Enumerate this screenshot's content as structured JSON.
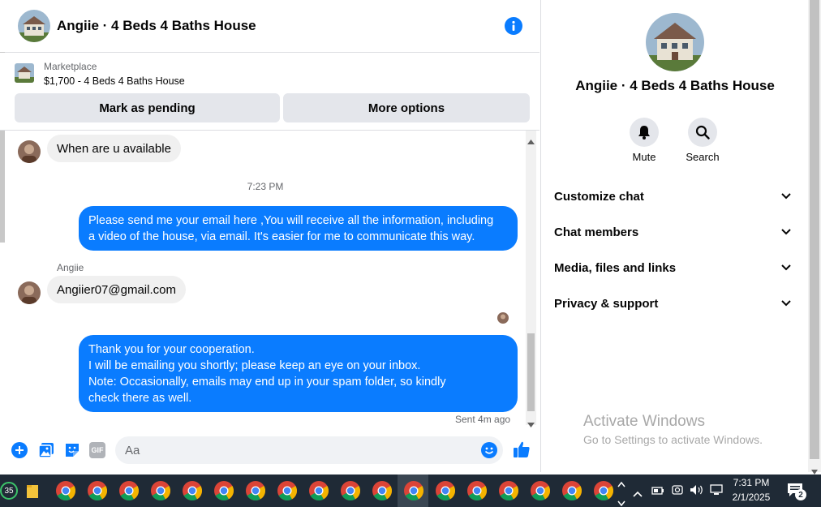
{
  "header": {
    "title": "Angiie · 4 Beds 4 Baths House",
    "info_icon": "info-icon"
  },
  "listing": {
    "source": "Marketplace",
    "title": "$1,700 - 4 Beds 4 Baths House",
    "pending_label": "Mark as pending",
    "more_label": "More options"
  },
  "messages": {
    "m1": "When are u available",
    "timestamp": "7:23 PM",
    "m2_lines": [
      "Please send me your email here ,You will receive all the information, including",
      "a video of the house, via email. It's easier for me to communicate this way."
    ],
    "sender": "Angiie",
    "m3": "Angiier07@gmail.com",
    "m4_lines": [
      "Thank you for your cooperation.",
      "I will be emailing you shortly; please keep an eye on your inbox.",
      "Note: Occasionally, emails may end up in your spam folder, so kindly",
      "check there as well."
    ],
    "sent_status": "Sent 4m ago"
  },
  "composer": {
    "placeholder": "Aa",
    "gif_label": "GIF"
  },
  "panel": {
    "title": "Angiie · 4 Beds 4 Baths House",
    "mute_label": "Mute",
    "search_label": "Search",
    "rows": [
      "Customize chat",
      "Chat members",
      "Media, files and links",
      "Privacy & support"
    ]
  },
  "watermark": {
    "title": "Activate Windows",
    "subtitle": "Go to Settings to activate Windows."
  },
  "taskbar": {
    "badge_left": "35",
    "time": "7:31 PM",
    "date": "2/1/2025",
    "notification_count": "2"
  },
  "colors": {
    "accent": "#0a7cff",
    "bubble_in": "#f0f0f0",
    "button_bg": "#e4e6eb",
    "taskbar_bg": "#1f2a36"
  }
}
